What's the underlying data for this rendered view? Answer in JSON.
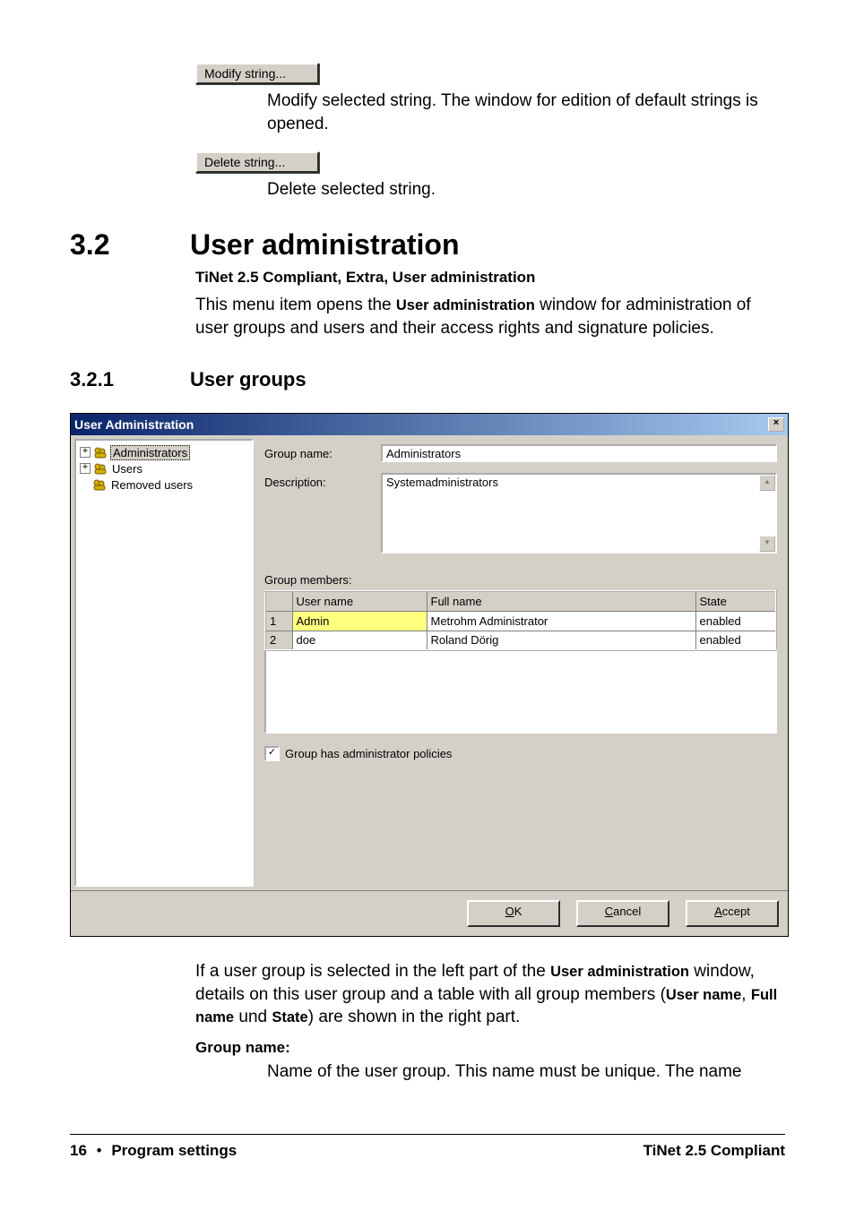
{
  "buttons": {
    "modify": "Modify string...",
    "delete": "Delete string..."
  },
  "descriptions": {
    "modify": "Modify selected string. The window for edition of default strings is opened.",
    "delete": "Delete selected string."
  },
  "section": {
    "num": "3.2",
    "title": "User administration",
    "path": "TiNet 2.5 Compliant, Extra, User administration",
    "intro_before": "This menu item opens the ",
    "intro_bold": "User administration",
    "intro_after": " window for administration of user groups and users and their access rights and signature policies."
  },
  "subsection": {
    "num": "3.2.1",
    "title": "User groups"
  },
  "dialog": {
    "title": "User Administration",
    "tree": {
      "administrators": "Administrators",
      "users": "Users",
      "removed": "Removed users"
    },
    "labels": {
      "group_name": "Group name:",
      "description": "Description:",
      "group_members": "Group members:",
      "admin_policies": "Group has administrator policies"
    },
    "values": {
      "group_name": "Administrators",
      "description": "Systemadministrators"
    },
    "table": {
      "headers": {
        "user": "User name",
        "full": "Full name",
        "state": "State"
      },
      "rows": [
        {
          "n": "1",
          "user": "Admin",
          "full": "Metrohm Administrator",
          "state": "enabled"
        },
        {
          "n": "2",
          "user": "doe",
          "full": "Roland Dörig",
          "state": "enabled"
        }
      ]
    },
    "footer": {
      "ok_u": "O",
      "ok_r": "K",
      "cancel_u": "C",
      "cancel_r": "ancel",
      "accept_u": "A",
      "accept_r": "ccept"
    }
  },
  "after": {
    "p1a": "If a user group is selected in the left part of the ",
    "p1b": "User administration",
    "p1c": " window, details on this user group and a table with all group members (",
    "p1d": "User name",
    "p1e": ", ",
    "p1f": "Full name",
    "p1g": " und ",
    "p1h": "State",
    "p1i": ") are shown in the right part.",
    "group_name_label": "Group name:",
    "group_name_desc": "Name of the user group. This name must be unique. The name"
  },
  "footer": {
    "page": "16",
    "section": "Program settings",
    "right": "TiNet 2.5 Compliant"
  }
}
